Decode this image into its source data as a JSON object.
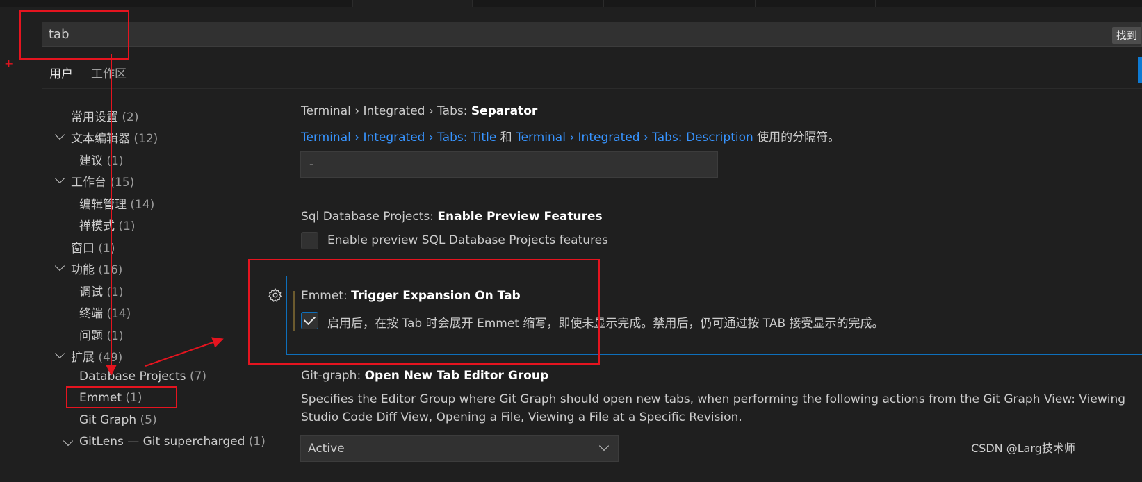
{
  "search": {
    "query": "tab",
    "found_label": "找到"
  },
  "scope_tabs": {
    "user": "用户",
    "workspace": "工作区"
  },
  "tree": [
    {
      "label": "常用设置",
      "count": "(2)"
    },
    {
      "label": "文本编辑器",
      "count": "(12)"
    },
    {
      "label": "建议",
      "count": "(1)"
    },
    {
      "label": "工作台",
      "count": "(15)"
    },
    {
      "label": "编辑管理",
      "count": "(14)"
    },
    {
      "label": "禅模式",
      "count": "(1)"
    },
    {
      "label": "窗口",
      "count": "(1)"
    },
    {
      "label": "功能",
      "count": "(16)"
    },
    {
      "label": "调试",
      "count": "(1)"
    },
    {
      "label": "终端",
      "count": "(14)"
    },
    {
      "label": "问题",
      "count": "(1)"
    },
    {
      "label": "扩展",
      "count": "(49)"
    },
    {
      "label": "Database Projects",
      "count": "(7)"
    },
    {
      "label": "Emmet",
      "count": "(1)"
    },
    {
      "label": "Git Graph",
      "count": "(5)"
    },
    {
      "label": "GitLens — Git supercharged",
      "count": "(1)"
    }
  ],
  "settings": {
    "separator": {
      "category": "Terminal › Integrated › Tabs: ",
      "name": "Separator",
      "link1": "Terminal › Integrated › Tabs: Title",
      "join": " 和 ",
      "link2": "Terminal › Integrated › Tabs: Description",
      "desc_tail": " 使用的分隔符。",
      "value": "-"
    },
    "sql": {
      "category": "Sql Database Projects: ",
      "name": "Enable Preview Features",
      "checkbox_label": "Enable preview SQL Database Projects features",
      "checked": false
    },
    "emmet": {
      "category": "Emmet: ",
      "name": "Trigger Expansion On Tab",
      "checkbox_label": "启用后，在按 Tab 时会展开 Emmet 缩写，即使未显示完成。禁用后，仍可通过按 TAB 接受显示的完成。",
      "checked": true
    },
    "gitgraph": {
      "category": "Git-graph: ",
      "name": "Open New Tab Editor Group",
      "desc1": "Specifies the Editor Group where Git Graph should open new tabs, when performing the following actions from the Git Graph View: Viewing",
      "desc2": "Studio Code Diff View, Opening a File, Viewing a File at a Specific Revision.",
      "value": "Active"
    }
  },
  "annotation": {
    "plus": "+"
  },
  "watermark": "CSDN @Larg技术师",
  "colors": {
    "accent": "#0e7ad3",
    "link": "#3794ff",
    "annotation_red": "#e5141f",
    "background": "#1f1f1f"
  }
}
